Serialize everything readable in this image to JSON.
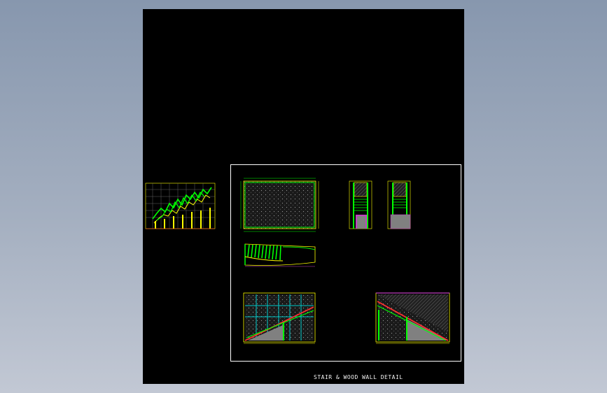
{
  "app": {
    "name": "CAD drawing viewer",
    "background_top": "#8797ae",
    "background_bottom": "#c2c8d4"
  },
  "sheet": {
    "background": "#000000",
    "title": "STAIR & WOOD WALL DETAIL",
    "frame_color": "#ffffff",
    "line_colors": {
      "green": "#00ff00",
      "yellow": "#ffff00",
      "cyan": "#00c8c8",
      "red": "#ff3030",
      "magenta": "#c040c0",
      "white": "#ffffff",
      "gray_fill": "#808080"
    }
  },
  "details": [
    {
      "id": "elevation-sketch"
    },
    {
      "id": "wall-plan"
    },
    {
      "id": "section-a"
    },
    {
      "id": "section-b"
    },
    {
      "id": "curved-stair-plan"
    },
    {
      "id": "stair-elevation-left"
    },
    {
      "id": "stair-elevation-right"
    }
  ]
}
